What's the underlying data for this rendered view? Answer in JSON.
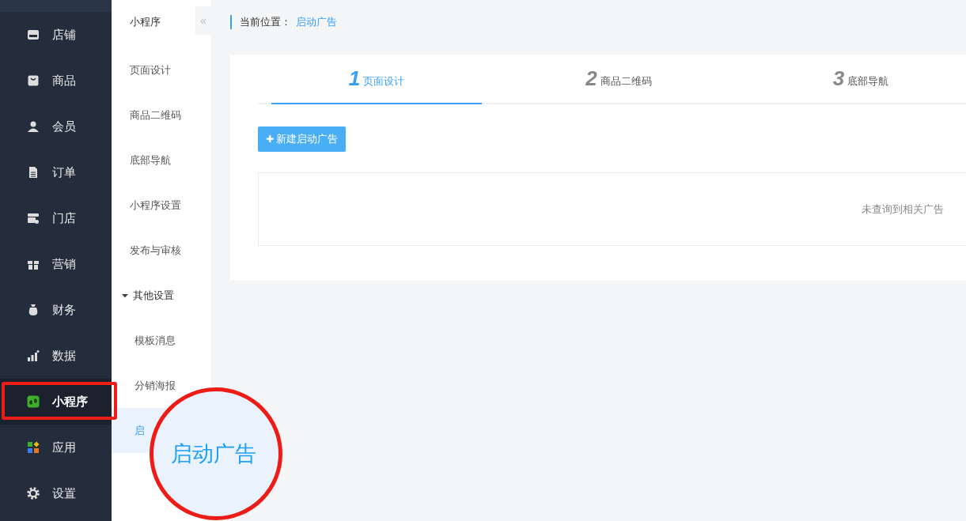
{
  "sidebar": {
    "items": [
      {
        "label": "店铺",
        "selected": false,
        "highlighted": false
      },
      {
        "label": "商品",
        "selected": false,
        "highlighted": false
      },
      {
        "label": "会员",
        "selected": false,
        "highlighted": false
      },
      {
        "label": "订单",
        "selected": false,
        "highlighted": false
      },
      {
        "label": "门店",
        "selected": false,
        "highlighted": false
      },
      {
        "label": "营销",
        "selected": false,
        "highlighted": false
      },
      {
        "label": "财务",
        "selected": false,
        "highlighted": false
      },
      {
        "label": "数据",
        "selected": false,
        "highlighted": false
      },
      {
        "label": "小程序",
        "selected": true,
        "highlighted": true
      },
      {
        "label": "应用",
        "selected": false,
        "highlighted": false
      },
      {
        "label": "设置",
        "selected": false,
        "highlighted": false
      }
    ]
  },
  "subnav": {
    "title": "小程序",
    "collapse": "«",
    "items": [
      {
        "label": "页面设计",
        "selected": false
      },
      {
        "label": "商品二维码",
        "selected": false
      },
      {
        "label": "底部导航",
        "selected": false
      },
      {
        "label": "小程序设置",
        "selected": false
      },
      {
        "label": "发布与审核",
        "selected": false
      },
      {
        "label": "其他设置",
        "selected": false,
        "expanded": true,
        "children": [
          {
            "label": "模板消息",
            "selected": false
          },
          {
            "label": "分销海报",
            "selected": false
          },
          {
            "label": "启",
            "selected": true
          }
        ]
      }
    ]
  },
  "breadcrumb": {
    "label": "当前位置：",
    "current": "启动广告"
  },
  "steps": [
    {
      "number": "1",
      "label": "页面设计",
      "selected": true
    },
    {
      "number": "2",
      "label": "商品二维码",
      "selected": false
    },
    {
      "number": "3",
      "label": "底部导航",
      "selected": false
    }
  ],
  "new_button": {
    "icon": "✚",
    "label": "新建启动广告"
  },
  "empty_message": "未查询到相关广告",
  "magnifier": {
    "label": "启动广告"
  }
}
